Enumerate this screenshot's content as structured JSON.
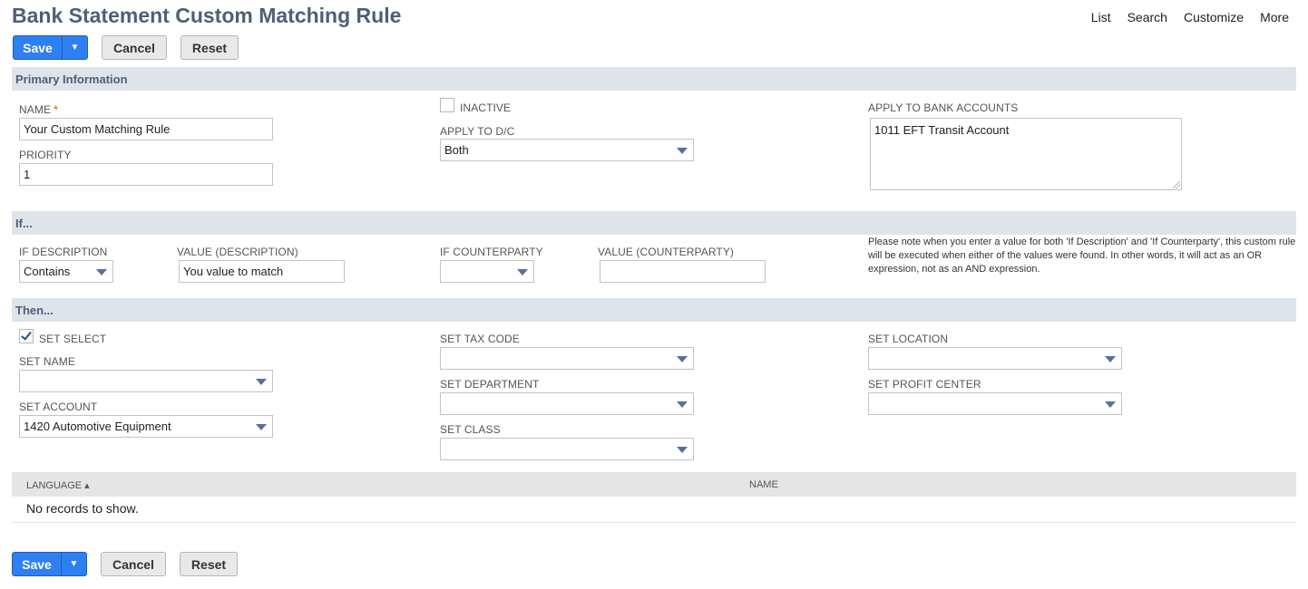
{
  "title": "Bank Statement Custom Matching Rule",
  "nav": [
    "List",
    "Search",
    "Customize",
    "More"
  ],
  "buttons": {
    "save": "Save",
    "cancel": "Cancel",
    "reset": "Reset",
    "save_menu_arrow": "▼"
  },
  "sections": {
    "primary": "Primary Information",
    "if": "If...",
    "then": "Then..."
  },
  "primary": {
    "name_label": "NAME",
    "name_required": "*",
    "name_value": "Your Custom Matching Rule",
    "priority_label": "PRIORITY",
    "priority_value": "1",
    "inactive_label": "INACTIVE",
    "inactive_checked": false,
    "apply_dc_label": "APPLY TO D/C",
    "apply_dc_value": "Both",
    "apply_accounts_label": "APPLY TO BANK ACCOUNTS",
    "apply_accounts_value": "1011 EFT Transit Account"
  },
  "if": {
    "if_description_label": "IF DESCRIPTION",
    "if_description_value": "Contains",
    "value_description_label": "VALUE (DESCRIPTION)",
    "value_description_value": "You value to match",
    "if_counterparty_label": "IF COUNTERPARTY",
    "if_counterparty_value": "",
    "value_counterparty_label": "VALUE (COUNTERPARTY)",
    "value_counterparty_value": "",
    "note": "Please note when you enter a value for both 'If Description' and 'If Counterparty', this custom rule will be executed when either of the values were found. In other words, it will act as an OR expression, not as an AND expression."
  },
  "then": {
    "set_select_label": "SET SELECT",
    "set_select_checked": true,
    "set_name_label": "SET NAME",
    "set_name_value": "",
    "set_account_label": "SET ACCOUNT",
    "set_account_value": "1420 Automotive Equipment",
    "set_tax_code_label": "SET TAX CODE",
    "set_department_label": "SET DEPARTMENT",
    "set_class_label": "SET CLASS",
    "set_location_label": "SET LOCATION",
    "set_profit_center_label": "SET PROFIT CENTER"
  },
  "table": {
    "columns": [
      "LANGUAGE ▴",
      "NAME"
    ],
    "empty_message": "No records to show."
  }
}
